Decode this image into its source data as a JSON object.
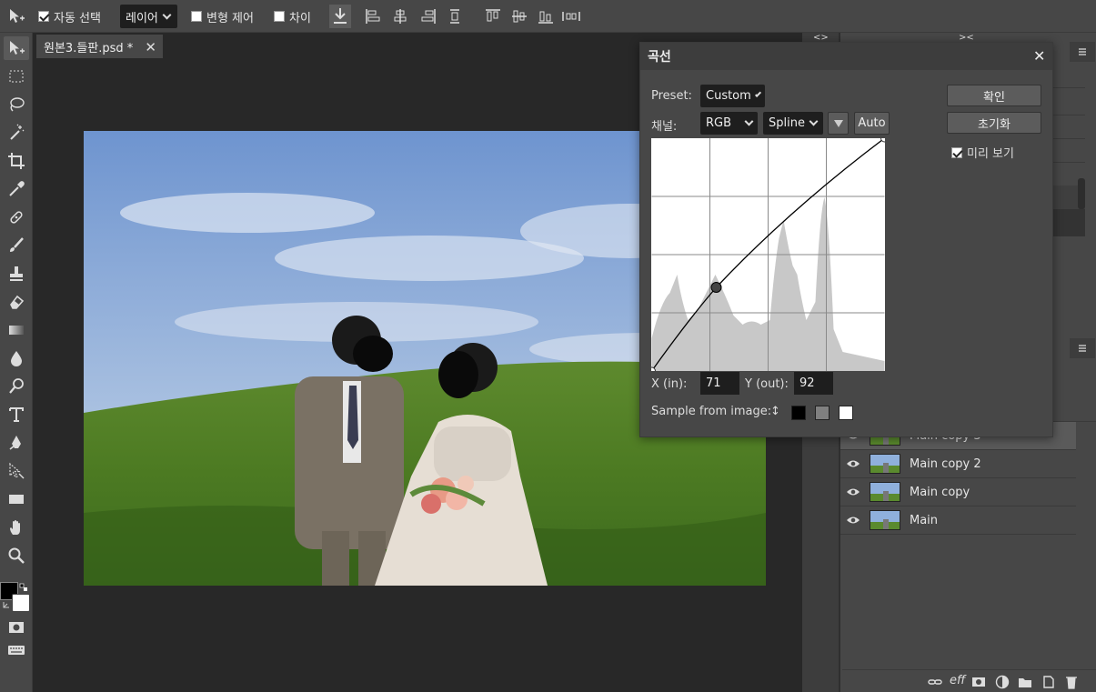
{
  "options_bar": {
    "auto_select_label": "자동 선택",
    "auto_select_checked": true,
    "target_value": "레이어",
    "transform_label": "변형 제어",
    "transform_checked": false,
    "diff_label": "차이",
    "diff_checked": false
  },
  "document": {
    "tab_title": "원본3.들판.psd *",
    "close_glyph": "✕"
  },
  "panel_toggles": {
    "left": "<>",
    "right": "><"
  },
  "layers": [
    {
      "name": "Main copy 3",
      "visible": true
    },
    {
      "name": "Main copy 2",
      "visible": true
    },
    {
      "name": "Main copy",
      "visible": true
    },
    {
      "name": "Main",
      "visible": true
    }
  ],
  "layers_footer_text": "eff",
  "curves_dialog": {
    "title": "곡선",
    "close_glyph": "✕",
    "preset_label": "Preset:",
    "preset_value": "Custom",
    "channel_label": "채널:",
    "channel_value": "RGB",
    "interp_value": "Spline",
    "auto_label": "Auto",
    "ok_label": "확인",
    "reset_label": "초기화",
    "preview_label": "미리 보기",
    "preview_checked": true,
    "x_label": "X (in):",
    "x_value": "71",
    "y_label": "Y (out):",
    "y_value": "92",
    "sample_label": "Sample from image:",
    "sample_arrow": "↕",
    "swatch_colors": [
      "#000000",
      "#808080",
      "#ffffff"
    ]
  },
  "colors": {
    "foreground": "#000000",
    "background": "#ffffff",
    "ui_panel": "#474747",
    "canvas_bg": "#282828"
  }
}
